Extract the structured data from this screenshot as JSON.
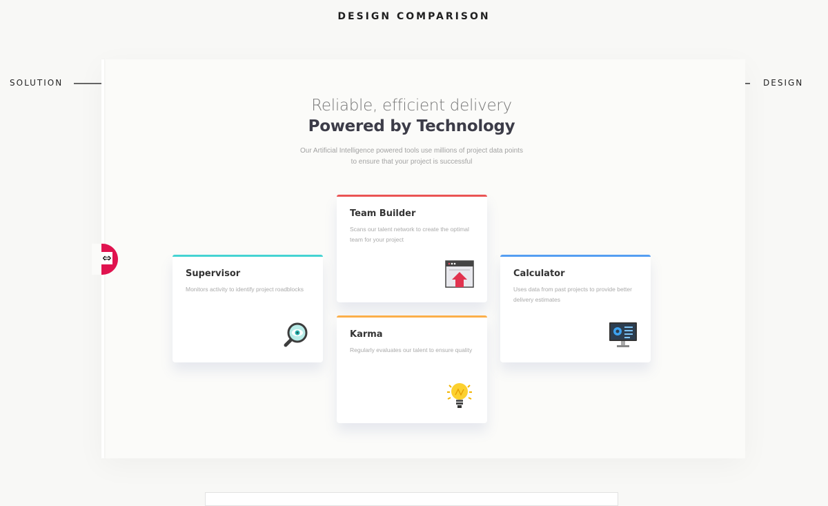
{
  "page": {
    "heading": "DESIGN COMPARISON",
    "left_label": "SOLUTION",
    "right_label": "DESIGN"
  },
  "comparison": {
    "handle_icon": "resize-horizontal-icon",
    "handle_glyph": "⇔",
    "handle_color": "#e0134f"
  },
  "hero": {
    "subtitle": "Reliable, efficient delivery",
    "title": "Powered by Technology",
    "description": "Our Artificial Intelligence powered tools use millions of project data points to ensure that your project is successful"
  },
  "cards": {
    "supervisor": {
      "title": "Supervisor",
      "description": "Monitors activity to identify project roadblocks",
      "accent": "#44d3d2",
      "icon": "magnifier-eye-icon"
    },
    "team_builder": {
      "title": "Team Builder",
      "description": "Scans our talent network to create the optimal team for your project",
      "accent": "#ea5454",
      "icon": "browser-upload-icon"
    },
    "karma": {
      "title": "Karma",
      "description": "Regularly evaluates our talent to ensure quality",
      "accent": "#fcaf4a",
      "icon": "lightbulb-icon"
    },
    "calculator": {
      "title": "Calculator",
      "description": "Uses data from past projects to provide better delivery estimates",
      "accent": "#549ef2",
      "icon": "monitor-dashboard-icon"
    }
  }
}
